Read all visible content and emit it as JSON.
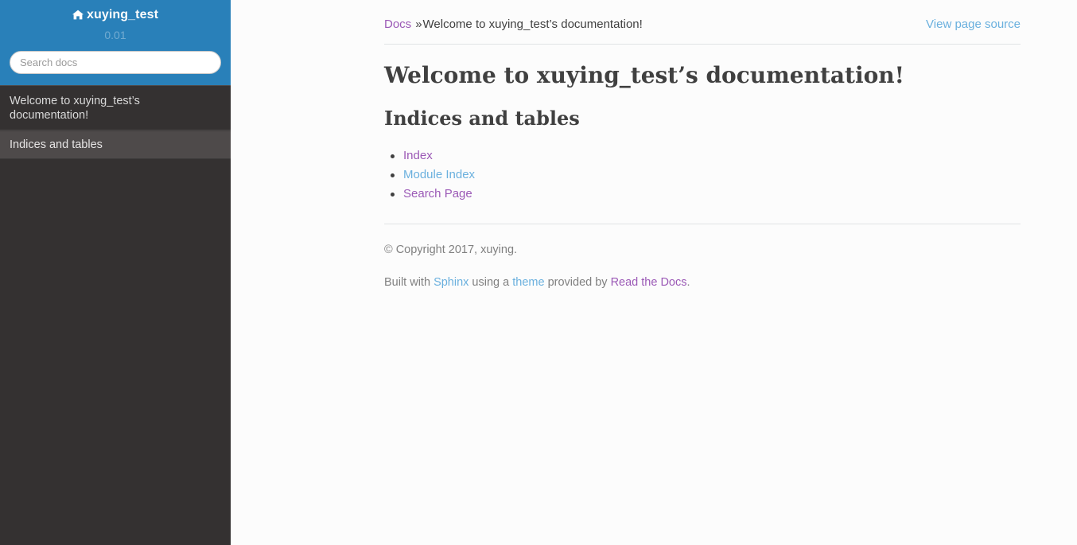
{
  "sidebar": {
    "logo": {
      "icon": "home-icon",
      "label": "xuying_test"
    },
    "version": "0.01",
    "search": {
      "placeholder": "Search docs",
      "value": ""
    },
    "nav_items": [
      {
        "label": "Welcome to xuying_test’s documentation!",
        "current": false
      },
      {
        "label": "Indices and tables",
        "current": true
      }
    ],
    "colors": {
      "header_bg": "#2980b9",
      "body_bg": "#343131",
      "current_item_bg": "#4e4a4a"
    }
  },
  "breadcrumb": {
    "home_label": "Docs",
    "separator": "»",
    "current_label": "Welcome to xuying_test’s documentation!",
    "view_source_label": "View page source"
  },
  "document": {
    "title": "Welcome to xuying_test’s documentation!",
    "section_heading": "Indices and tables",
    "links": [
      {
        "label": "Index",
        "state": "visited"
      },
      {
        "label": "Module Index",
        "state": "unvisited"
      },
      {
        "label": "Search Page",
        "state": "visited"
      }
    ]
  },
  "footer": {
    "copyright": "© Copyright 2017, xuying.",
    "built_prefix": "Built with ",
    "sphinx_label": "Sphinx",
    "built_middle": " using a ",
    "theme_label": "theme",
    "built_middle2": " provided by ",
    "rtd_label": "Read the Docs",
    "built_suffix": "."
  },
  "colors": {
    "link_visited": "#9b59b6",
    "link_unvisited": "#6ab0de",
    "text": "#404040",
    "muted": "#808080",
    "page_bg": "#fcfcfc"
  }
}
